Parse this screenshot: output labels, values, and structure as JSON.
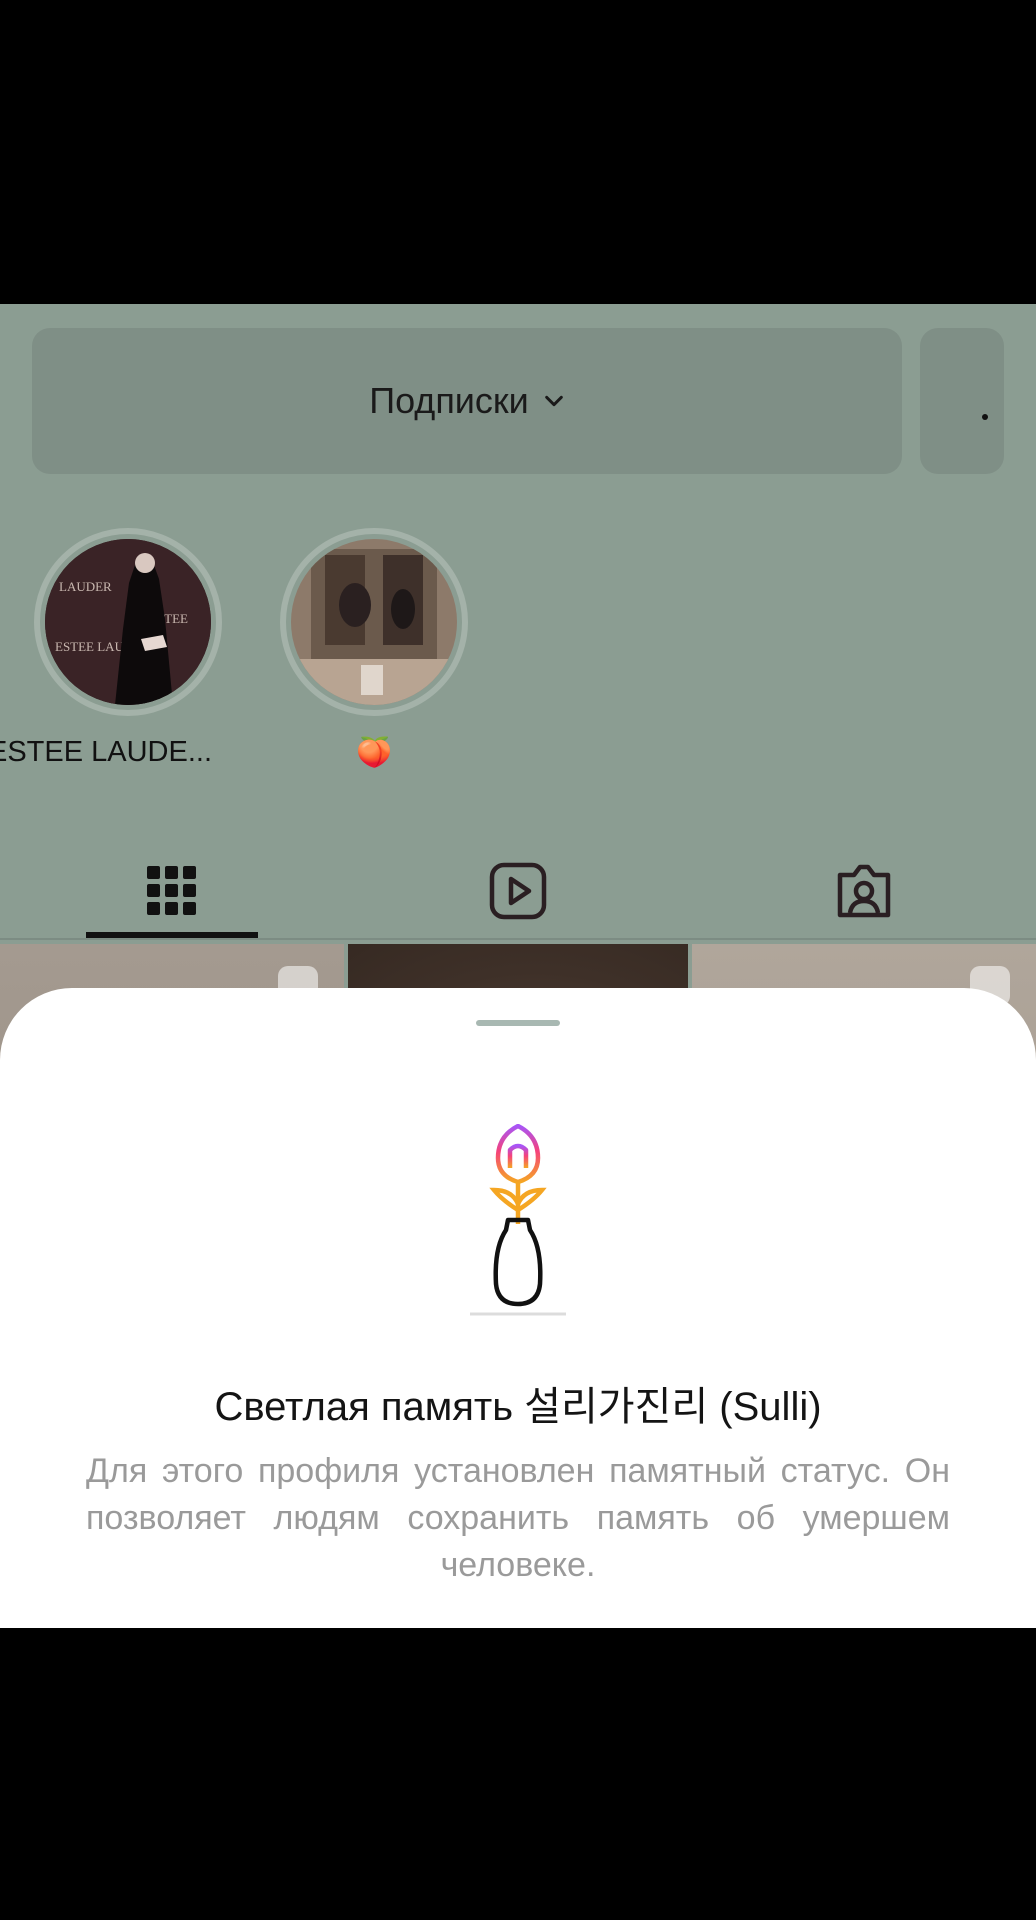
{
  "profile": {
    "following_button_label": "Подписки",
    "more_button_label": "•"
  },
  "highlights": [
    {
      "label": "ESTEE LAUDE..."
    },
    {
      "label": "🍑"
    }
  ],
  "tabs": [
    {
      "name": "grid",
      "icon": "grid-icon"
    },
    {
      "name": "reels",
      "icon": "reels-icon"
    },
    {
      "name": "tagged",
      "icon": "tagged-icon"
    }
  ],
  "memorial_sheet": {
    "title": "Светлая память 설리가진리 (Sulli)",
    "description": "Для этого профиля установлен памятный статус. Он позволяет людям сохранить память об умершем человеке.",
    "icon": "memorial-flower-vase-icon"
  },
  "colors": {
    "overlay": "#8b9d92",
    "sheet": "#ffffff",
    "flower_gradient": [
      "#a855f7",
      "#f5427b",
      "#f5a623"
    ]
  }
}
